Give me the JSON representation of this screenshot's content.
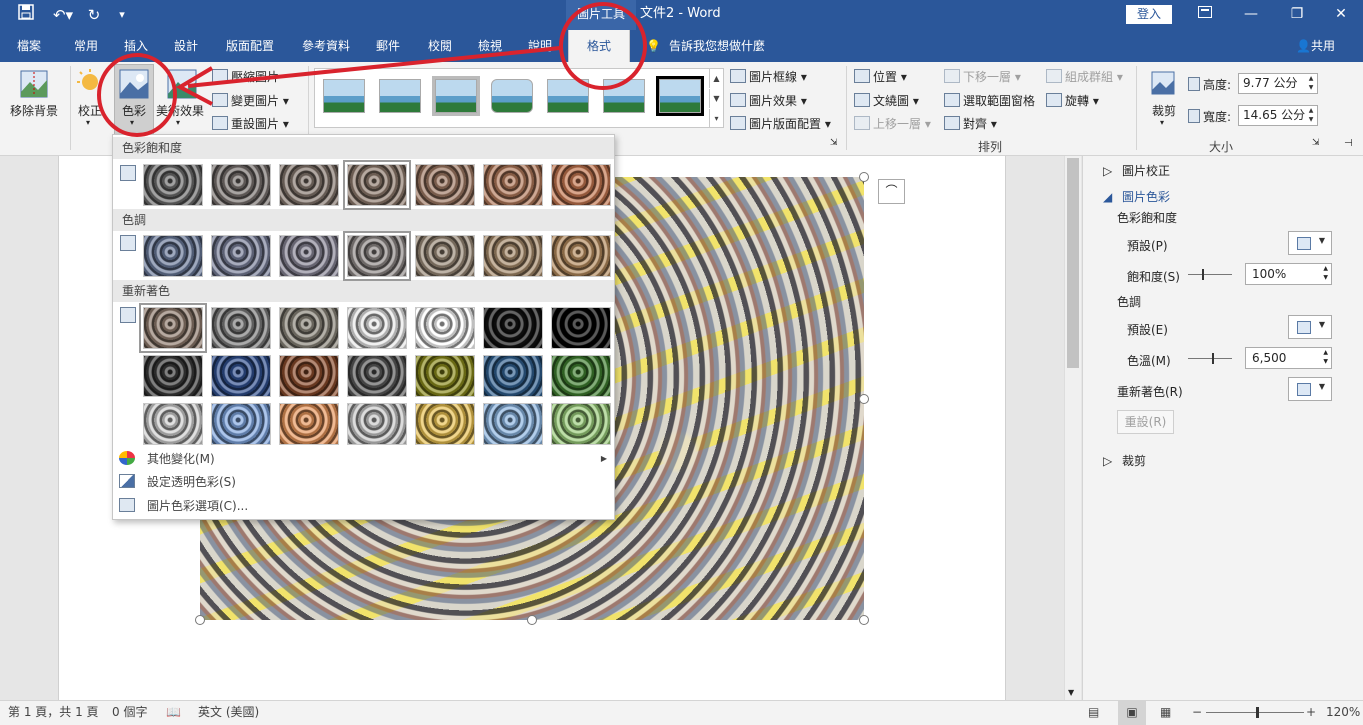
{
  "titlebar": {
    "tool_context": "圖片工具",
    "doc_title": "文件2 - Word",
    "login": "登入"
  },
  "tabs": [
    "檔案",
    "常用",
    "插入",
    "設計",
    "版面配置",
    "參考資料",
    "郵件",
    "校閱",
    "檢視",
    "說明",
    "格式"
  ],
  "tell_me": "告訴我您想做什麼",
  "share": "共用",
  "ribbon": {
    "remove_bg": "移除背景",
    "corrections": "校正",
    "color": "色彩",
    "artistic": "美術效果",
    "compress": "壓縮圖片",
    "change": "變更圖片",
    "reset": "重設圖片",
    "border": "圖片框線",
    "effects": "圖片效果",
    "layout": "圖片版面配置",
    "position": "位置",
    "wrap": "文繞圖",
    "forward": "上移一層",
    "backward": "下移一層",
    "selection_pane": "選取範圍窗格",
    "align": "對齊",
    "group": "組成群組",
    "rotate": "旋轉",
    "arrange_label": "排列",
    "crop": "裁剪",
    "height_label": "高度:",
    "height_value": "9.77 公分",
    "width_label": "寬度:",
    "width_value": "14.65 公分",
    "size_label": "大小"
  },
  "color_menu": {
    "saturation_header": "色彩飽和度",
    "tone_header": "色調",
    "recolor_header": "重新著色",
    "more_variations": "其他變化(M)",
    "set_transparent": "設定透明色彩(S)",
    "picture_color_options": "圖片色彩選項(C)...",
    "saturation_thumbs": [
      "#6e6e6e",
      "#7a7370",
      "#86786f",
      "#8f7b6d",
      "#a07a64",
      "#b2795a",
      "#c4764f"
    ],
    "tone_thumbs": [
      "#6a7a9a",
      "#7a809a",
      "#888596",
      "#908a88",
      "#9a8a78",
      "#a68a6a",
      "#b48a5c"
    ],
    "recolor_thumbs": [
      [
        "#8f7b6d",
        "#7d7d7d",
        "#8a857a",
        "#e8e8e8",
        "#ffffff",
        "#111111",
        "#000000"
      ],
      [
        "#3a3a3a",
        "#2f4f8f",
        "#8a4a2a",
        "#5a5a5a",
        "#8a8a1a",
        "#2f5f8f",
        "#3f7f2f"
      ],
      [
        "#d0d0d0",
        "#7fa6e0",
        "#e8955a",
        "#cacaca",
        "#e8c050",
        "#8ab4e0",
        "#9acd7a"
      ]
    ]
  },
  "pane": {
    "corrections": "圖片校正",
    "color": "圖片色彩",
    "saturation": "色彩飽和度",
    "preset1": "預設(P)",
    "saturation_label": "飽和度(S)",
    "saturation_value": "100%",
    "tone": "色調",
    "preset2": "預設(E)",
    "temperature_label": "色溫(M)",
    "temperature_value": "6,500",
    "recolor": "重新著色(R)",
    "reset": "重設(R)",
    "crop": "裁剪"
  },
  "status": {
    "page": "第 1 頁，共 1 頁",
    "words": "0 個字",
    "language": "英文 (美國)",
    "zoom": "120%"
  },
  "colors": {
    "word_blue": "#2b579a",
    "annotation_red": "#d9232d"
  }
}
